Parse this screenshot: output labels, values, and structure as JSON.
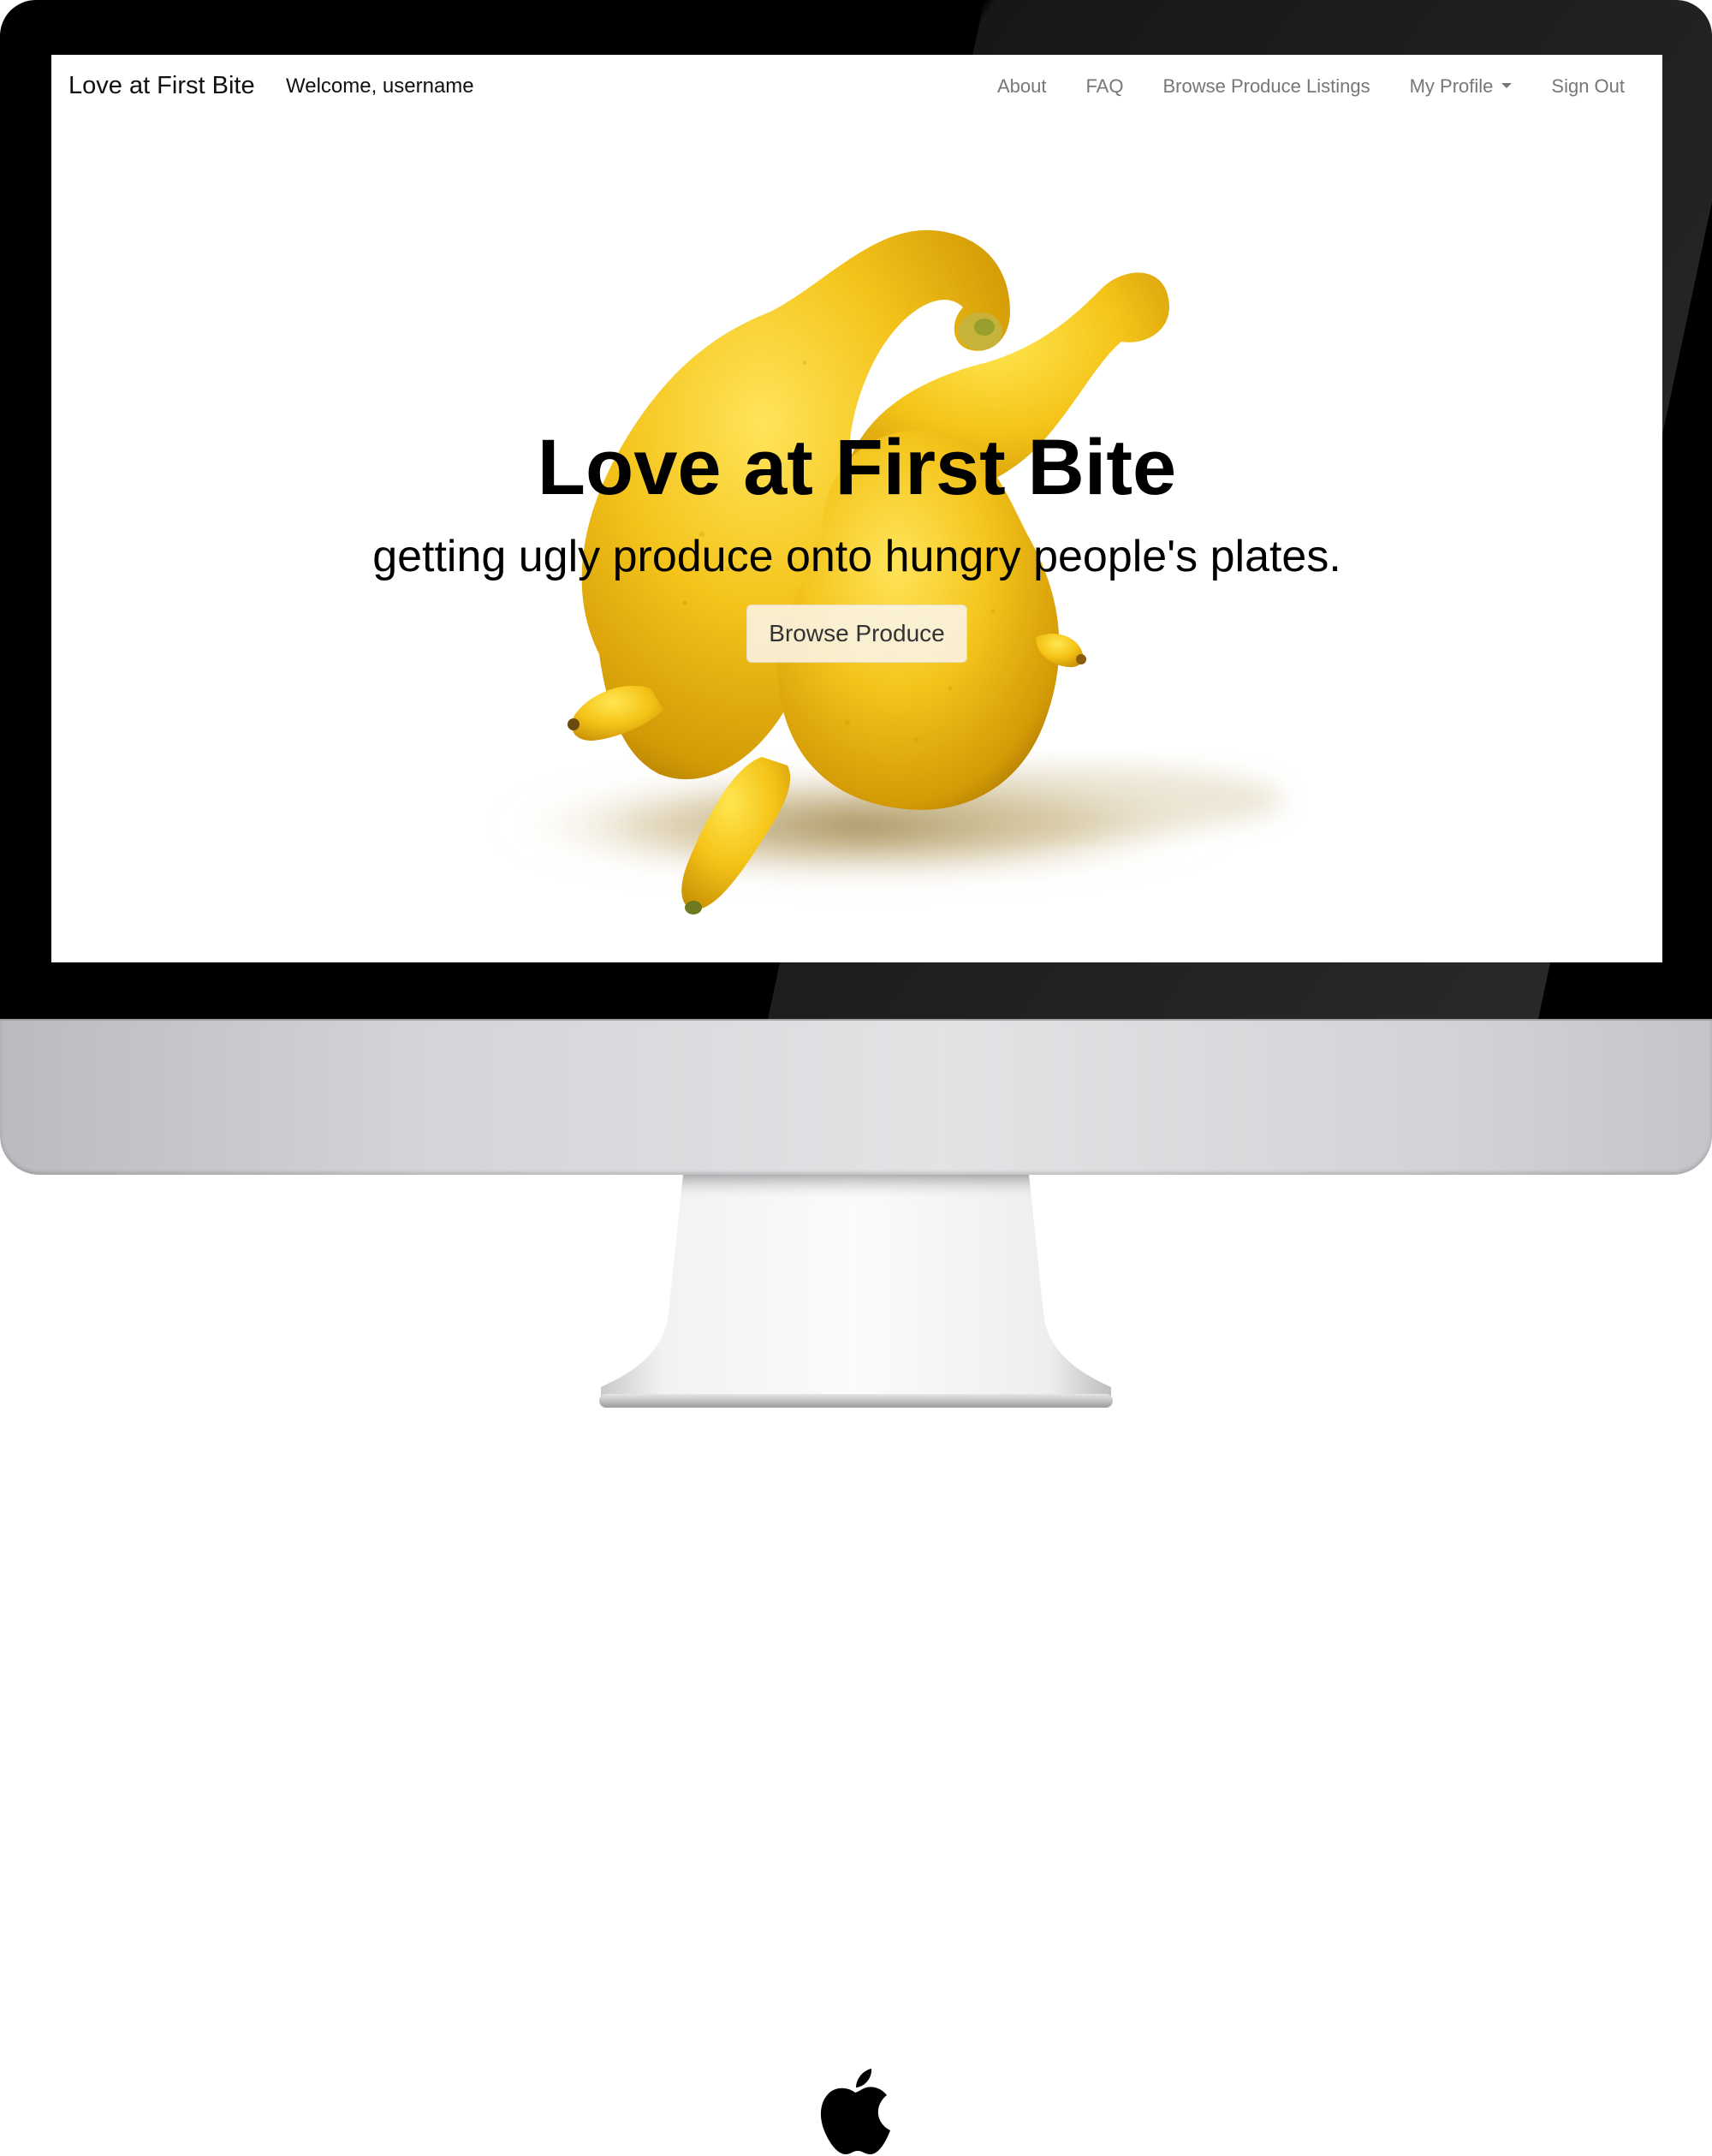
{
  "nav": {
    "brand": "Love at First Bite",
    "welcome": "Welcome, username",
    "links": {
      "about": "About",
      "faq": "FAQ",
      "browse_listings": "Browse Produce Listings",
      "my_profile": "My Profile",
      "sign_out": "Sign Out"
    }
  },
  "hero": {
    "title": "Love at First Bite",
    "subtitle": "getting ugly produce onto hungry people's plates.",
    "button_label": "Browse Produce",
    "image_subject": "misshapen-lemons-photo"
  },
  "device": {
    "type": "imac-mockup",
    "logo": "apple-logo-icon"
  },
  "colors": {
    "nav_text": "#777777",
    "brand_text": "#111111",
    "lemon": "#f2c21a",
    "bezel": "#000000"
  }
}
